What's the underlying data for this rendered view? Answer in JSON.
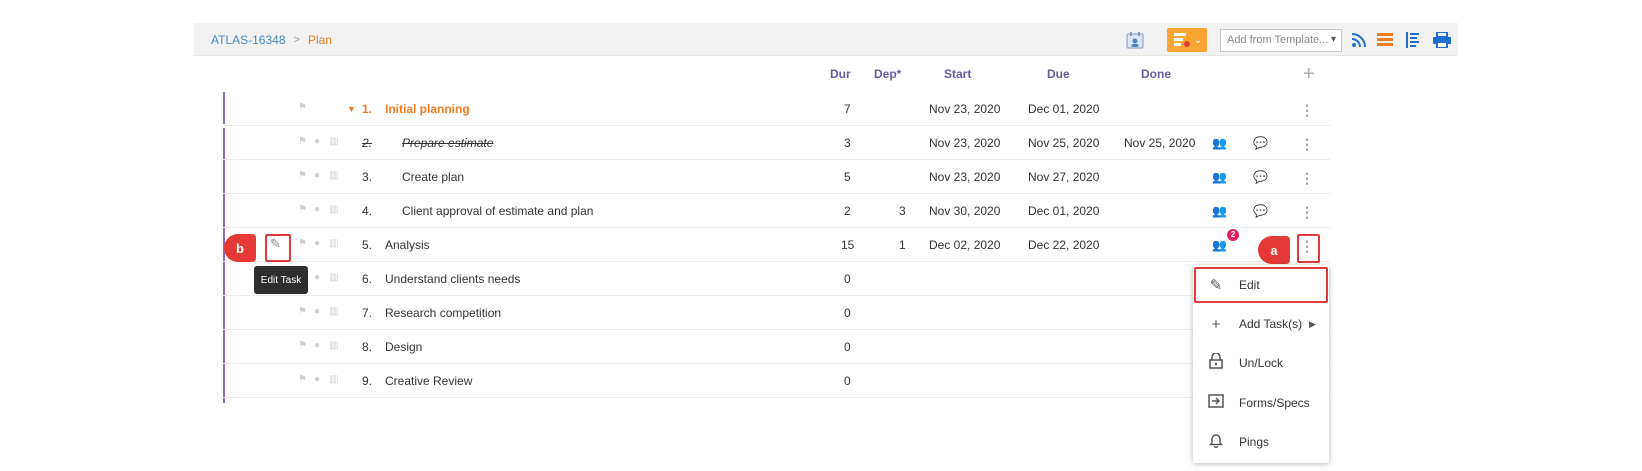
{
  "breadcrumb": {
    "project": "ATLAS-16348",
    "separator": ">",
    "current": "Plan"
  },
  "toolbar": {
    "template_placeholder": "Add from Template...",
    "gantt_caret": "⌄"
  },
  "columns": {
    "dur": "Dur",
    "dep": "Dep*",
    "start": "Start",
    "due": "Due",
    "done": "Done"
  },
  "tasks": [
    {
      "num": "1.",
      "title": "Initial planning",
      "dur": "7",
      "dep": "",
      "start": "Nov 23, 2020",
      "due": "Dec 01, 2020",
      "done": ""
    },
    {
      "num": "2.",
      "title": "Prepare estimate",
      "dur": "3",
      "dep": "",
      "start": "Nov 23, 2020",
      "due": "Nov 25, 2020",
      "done": "Nov 25, 2020"
    },
    {
      "num": "3.",
      "title": "Create plan",
      "dur": "5",
      "dep": "",
      "start": "Nov 23, 2020",
      "due": "Nov 27, 2020",
      "done": ""
    },
    {
      "num": "4.",
      "title": "Client approval of estimate and plan",
      "dur": "2",
      "dep": "3",
      "start": "Nov 30, 2020",
      "due": "Dec 01, 2020",
      "done": ""
    },
    {
      "num": "5.",
      "title": "Analysis",
      "dur": "15",
      "dep": "1",
      "start": "Dec 02, 2020",
      "due": "Dec 22, 2020",
      "done": "",
      "badge": "2"
    },
    {
      "num": "6.",
      "title": "Understand clients needs",
      "dur": "0",
      "dep": "",
      "start": "",
      "due": "",
      "done": ""
    },
    {
      "num": "7.",
      "title": "Research competition",
      "dur": "0",
      "dep": "",
      "start": "",
      "due": "",
      "done": ""
    },
    {
      "num": "8.",
      "title": "Design",
      "dur": "0",
      "dep": "",
      "start": "",
      "due": "",
      "done": ""
    },
    {
      "num": "9.",
      "title": "Creative Review",
      "dur": "0",
      "dep": "",
      "start": "",
      "due": "",
      "done": ""
    }
  ],
  "callouts": {
    "a": "a",
    "b": "b"
  },
  "tooltip": "Edit Task",
  "menu": [
    "Edit",
    "Add Task(s)",
    "Un/Lock",
    "Forms/Specs",
    "Pings"
  ],
  "colors": {
    "accent_orange": "#f07c22",
    "header_purple": "#6a5aa0",
    "highlight_red": "#e03a3a",
    "link_blue": "#4a86c5"
  }
}
